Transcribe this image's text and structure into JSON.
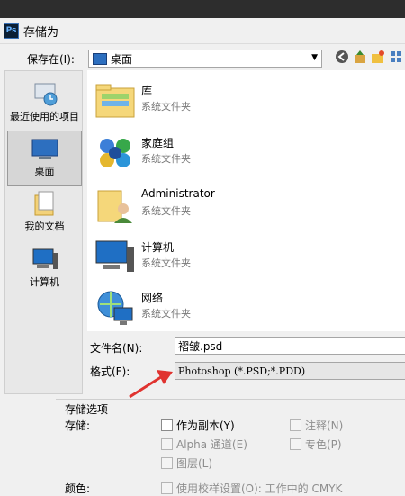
{
  "window": {
    "app_icon": "Ps",
    "title": "存储为"
  },
  "save_in": {
    "label": "保存在(I):",
    "value": "桌面"
  },
  "nav_icons": [
    "back-icon",
    "up-folder-icon",
    "new-folder-icon",
    "view-menu-icon"
  ],
  "places": [
    {
      "label": "最近使用的项目",
      "icon": "recent-items-icon"
    },
    {
      "label": "桌面",
      "icon": "desktop-icon",
      "selected": true
    },
    {
      "label": "我的文档",
      "icon": "documents-icon"
    },
    {
      "label": "计算机",
      "icon": "computer-icon"
    }
  ],
  "files": [
    {
      "name": "库",
      "type": "系统文件夹",
      "icon": "library-folder-icon"
    },
    {
      "name": "家庭组",
      "type": "系统文件夹",
      "icon": "homegroup-icon"
    },
    {
      "name": "Administrator",
      "type": "系统文件夹",
      "icon": "user-folder-icon"
    },
    {
      "name": "计算机",
      "type": "系统文件夹",
      "icon": "computer-icon"
    },
    {
      "name": "网络",
      "type": "系统文件夹",
      "icon": "network-icon"
    }
  ],
  "filename": {
    "label": "文件名(N):",
    "value": "褶皱.psd"
  },
  "format": {
    "label": "格式(F):",
    "value": "Photoshop (*.PSD;*.PDD)"
  },
  "save_options": {
    "section_title": "存储选项",
    "save_label": "存储:",
    "as_copy": "作为副本(Y)",
    "annotations": "注释(N)",
    "alpha": "Alpha 通道(E)",
    "spot_color": "专色(P)",
    "layers": "图层(L)",
    "color_label": "颜色:",
    "proof_setup": "使用校样设置(O): 工作中的 CMYK"
  },
  "colors": {
    "accent_arrow": "#e0332f",
    "desktop_blue": "#2d6fbf"
  }
}
